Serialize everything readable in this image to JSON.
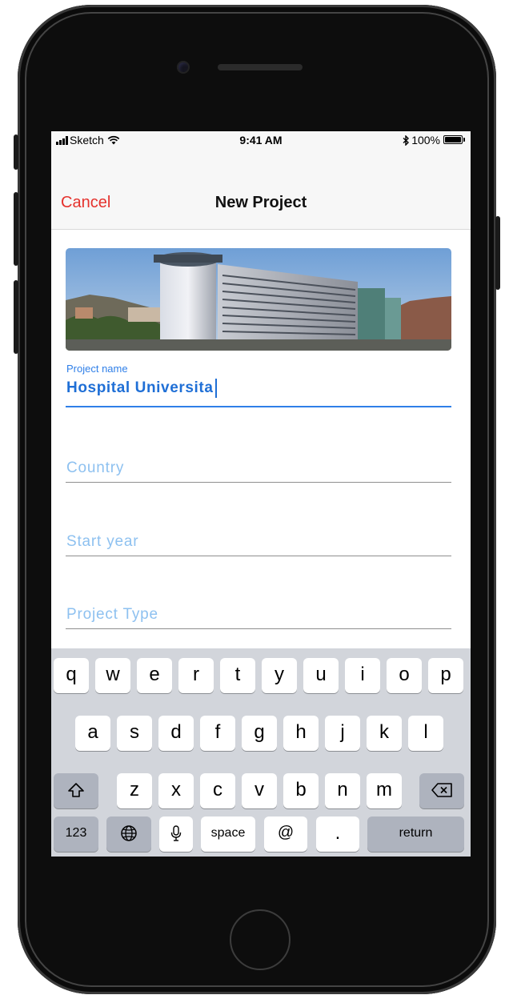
{
  "status_bar": {
    "carrier": "Sketch",
    "time": "9:41 AM",
    "battery": "100%"
  },
  "nav": {
    "cancel_label": "Cancel",
    "title": "New Project"
  },
  "form": {
    "project_name": {
      "label": "Project name",
      "value": "Hospital Universita"
    },
    "country": {
      "placeholder": "Country"
    },
    "start_year": {
      "placeholder": "Start year"
    },
    "project_type": {
      "placeholder": "Project Type"
    }
  },
  "keyboard": {
    "row1": [
      "q",
      "w",
      "e",
      "r",
      "t",
      "y",
      "u",
      "i",
      "o",
      "p"
    ],
    "row2": [
      "a",
      "s",
      "d",
      "f",
      "g",
      "h",
      "j",
      "k",
      "l"
    ],
    "row3": [
      "z",
      "x",
      "c",
      "v",
      "b",
      "n",
      "m"
    ],
    "numbers_label": "123",
    "space_label": "space",
    "at_label": "@",
    "period_label": ".",
    "return_label": "return",
    "shift_icon": "shift-icon",
    "delete_icon": "delete-icon",
    "globe_icon": "globe-icon",
    "mic_icon": "microphone-icon"
  },
  "colors": {
    "accent_blue": "#2f7fe8",
    "cancel_red": "#e5322d",
    "placeholder_blue": "#8ec1f0",
    "keyboard_bg": "#d2d5db"
  }
}
